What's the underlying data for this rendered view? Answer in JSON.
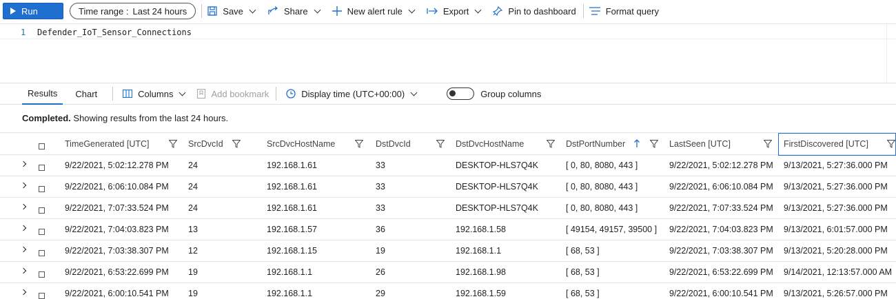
{
  "toolbar": {
    "run": "Run",
    "time_range_label": "Time range :",
    "time_range_value": "Last 24 hours",
    "save": "Save",
    "share": "Share",
    "new_alert": "New alert rule",
    "export": "Export",
    "pin": "Pin to dashboard",
    "format": "Format query"
  },
  "editor": {
    "line_number": "1",
    "query": "Defender_IoT_Sensor_Connections"
  },
  "results_bar": {
    "tab_results": "Results",
    "tab_chart": "Chart",
    "columns": "Columns",
    "add_bookmark": "Add bookmark",
    "display_time": "Display time (UTC+00:00)",
    "group_columns": "Group columns"
  },
  "status": {
    "bold": "Completed.",
    "text": " Showing results from the last 24 hours."
  },
  "table": {
    "columns": [
      "TimeGenerated [UTC]",
      "SrcDvcId",
      "SrcDvcHostName",
      "DstDvcId",
      "DstDvcHostName",
      "DstPortNumber",
      "LastSeen [UTC]",
      "FirstDiscovered [UTC]"
    ],
    "rows": [
      [
        "9/22/2021, 5:02:12.278 PM",
        "24",
        "192.168.1.61",
        "33",
        "DESKTOP-HLS7Q4K",
        "[ 0, 80, 8080, 443 ]",
        "9/22/2021, 5:02:12.278 PM",
        "9/13/2021, 5:27:36.000 PM"
      ],
      [
        "9/22/2021, 6:06:10.084 PM",
        "24",
        "192.168.1.61",
        "33",
        "DESKTOP-HLS7Q4K",
        "[ 0, 80, 8080, 443 ]",
        "9/22/2021, 6:06:10.084 PM",
        "9/13/2021, 5:27:36.000 PM"
      ],
      [
        "9/22/2021, 7:07:33.524 PM",
        "24",
        "192.168.1.61",
        "33",
        "DESKTOP-HLS7Q4K",
        "[ 0, 80, 8080, 443 ]",
        "9/22/2021, 7:07:33.524 PM",
        "9/13/2021, 5:27:36.000 PM"
      ],
      [
        "9/22/2021, 7:04:03.823 PM",
        "13",
        "192.168.1.57",
        "36",
        "192.168.1.58",
        "[ 49154, 49157, 39500 ]",
        "9/22/2021, 7:04:03.823 PM",
        "9/13/2021, 6:01:57.000 PM"
      ],
      [
        "9/22/2021, 7:03:38.307 PM",
        "12",
        "192.168.1.15",
        "19",
        "192.168.1.1",
        "[ 68, 53 ]",
        "9/22/2021, 7:03:38.307 PM",
        "9/13/2021, 5:20:28.000 PM"
      ],
      [
        "9/22/2021, 6:53:22.699 PM",
        "19",
        "192.168.1.1",
        "26",
        "192.168.1.98",
        "[ 68, 53 ]",
        "9/22/2021, 6:53:22.699 PM",
        "9/14/2021, 12:13:57.000 AM"
      ],
      [
        "9/22/2021, 6:00:10.541 PM",
        "19",
        "192.168.1.1",
        "29",
        "192.168.1.59",
        "[ 68, 53 ]",
        "9/22/2021, 6:00:10.541 PM",
        "9/13/2021, 5:26:57.000 PM"
      ]
    ]
  },
  "colors": {
    "accent": "#1f6fd1"
  }
}
